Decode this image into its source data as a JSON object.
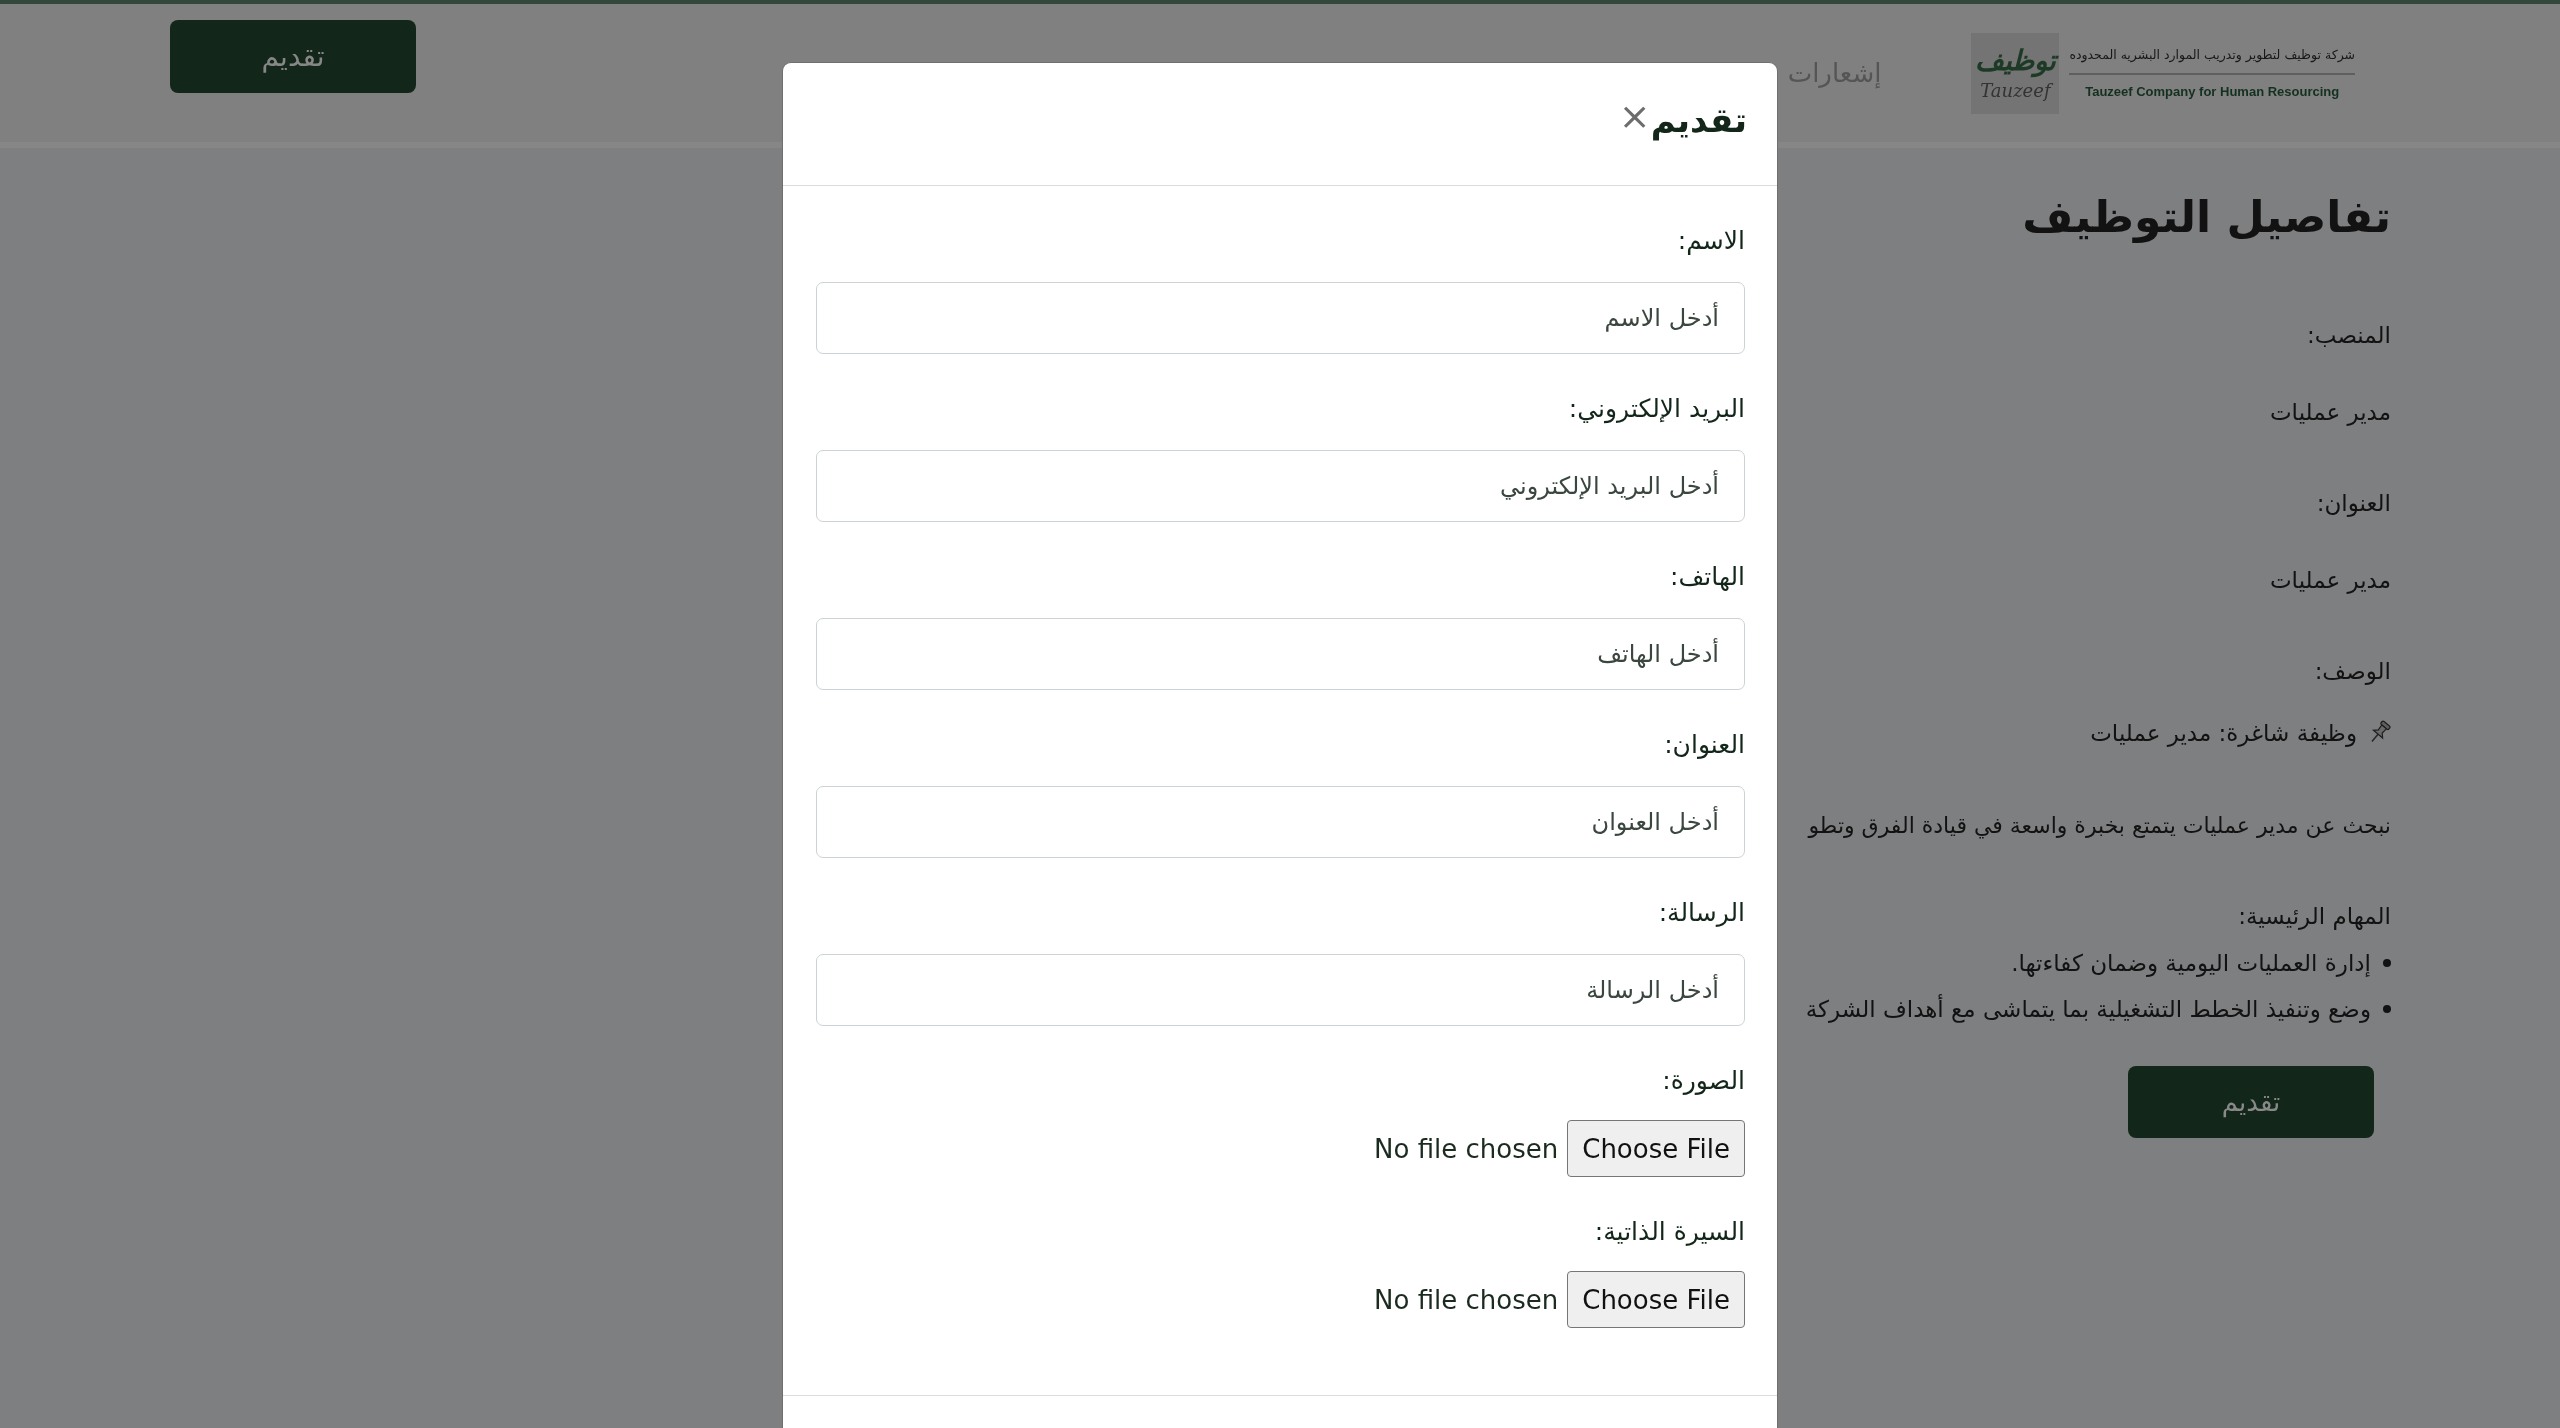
{
  "header": {
    "logo": {
      "calligraphy": "توظيف",
      "wordmark": "Tauzeef",
      "company_name_arabic": "شركة توظيف لتطوير وتدريب الموارد البشريه المحدوده",
      "company_name_english": "Tauzeef Company for Human Resourcing"
    },
    "nav": [
      {
        "label": "إشعارات"
      }
    ],
    "apply_button": "تقديم"
  },
  "job_details": {
    "title": "تفاصيل التوظيف",
    "fields": [
      {
        "label": "المنصب:",
        "value": "مدير عمليات"
      },
      {
        "label": "العنوان:",
        "value": "مدير عمليات"
      }
    ],
    "description": {
      "label": "الوصف:",
      "headline": "وظيفة شاغرة: مدير عمليات",
      "paragraph": "نبحث عن مدير عمليات يتمتع بخبرة واسعة في قيادة الفرق وتطو",
      "tasks_label": "المهام الرئيسية:",
      "tasks": [
        "إدارة العمليات اليومية وضمان كفاءتها.",
        "وضع وتنفيذ الخطط التشغيلية بما يتماشى مع أهداف الشركة"
      ]
    },
    "apply_button": "تقديم"
  },
  "modal": {
    "title": "تقديم",
    "close": "×",
    "fields": [
      {
        "kind": "text",
        "label": "الاسم:",
        "placeholder": "أدخل الاسم"
      },
      {
        "kind": "text",
        "label": "البريد الإلكتروني:",
        "placeholder": "أدخل البريد الإلكتروني"
      },
      {
        "kind": "text",
        "label": "الهاتف:",
        "placeholder": "أدخل الهاتف"
      },
      {
        "kind": "text",
        "label": "العنوان:",
        "placeholder": "أدخل العنوان"
      },
      {
        "kind": "text",
        "label": "الرسالة:",
        "placeholder": "أدخل الرسالة"
      },
      {
        "kind": "file",
        "label": "الصورة:",
        "button": "Choose File",
        "status": "No file chosen"
      },
      {
        "kind": "file",
        "label": "السيرة الذاتية:",
        "button": "Choose File",
        "status": "No file chosen"
      }
    ]
  }
}
